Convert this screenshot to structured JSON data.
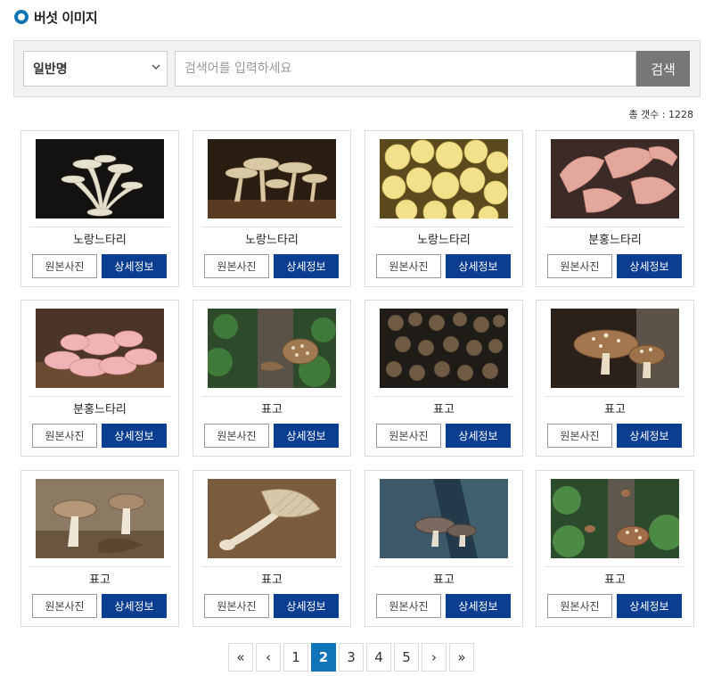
{
  "header": {
    "title": "버섯 이미지"
  },
  "search": {
    "select_value": "일반명",
    "placeholder": "검색어를 입력하세요",
    "button_label": "검색"
  },
  "total": {
    "label": "총 갯수 : 1228"
  },
  "card_buttons": {
    "original_label": "원본사진",
    "detail_label": "상세정보"
  },
  "items": [
    {
      "name": "노랑느타리",
      "image": "oyster-white-on-black"
    },
    {
      "name": "노랑느타리",
      "image": "oyster-cluster-on-log"
    },
    {
      "name": "노랑느타리",
      "image": "yellow-oyster-cluster"
    },
    {
      "name": "분홍느타리",
      "image": "pink-oyster-closeup"
    },
    {
      "name": "분홍느타리",
      "image": "pink-oyster-rosette"
    },
    {
      "name": "표고",
      "image": "shiitake-on-mossy-log"
    },
    {
      "name": "표고",
      "image": "shiitake-log-cluster"
    },
    {
      "name": "표고",
      "image": "shiitake-caps-closeup"
    },
    {
      "name": "표고",
      "image": "shiitake-pair-on-ground"
    },
    {
      "name": "표고",
      "image": "shiitake-gills-side"
    },
    {
      "name": "표고",
      "image": "shiitake-on-bark"
    },
    {
      "name": "표고",
      "image": "shiitake-forest-moss"
    }
  ],
  "pagination": {
    "first": "«",
    "prev": "‹",
    "pages": [
      "1",
      "2",
      "3",
      "4",
      "5"
    ],
    "current": "2",
    "next": "›",
    "last": "»"
  },
  "colors": {
    "accent": "#0f74b8",
    "detail_button": "#0b3d91",
    "search_button": "#777777"
  }
}
